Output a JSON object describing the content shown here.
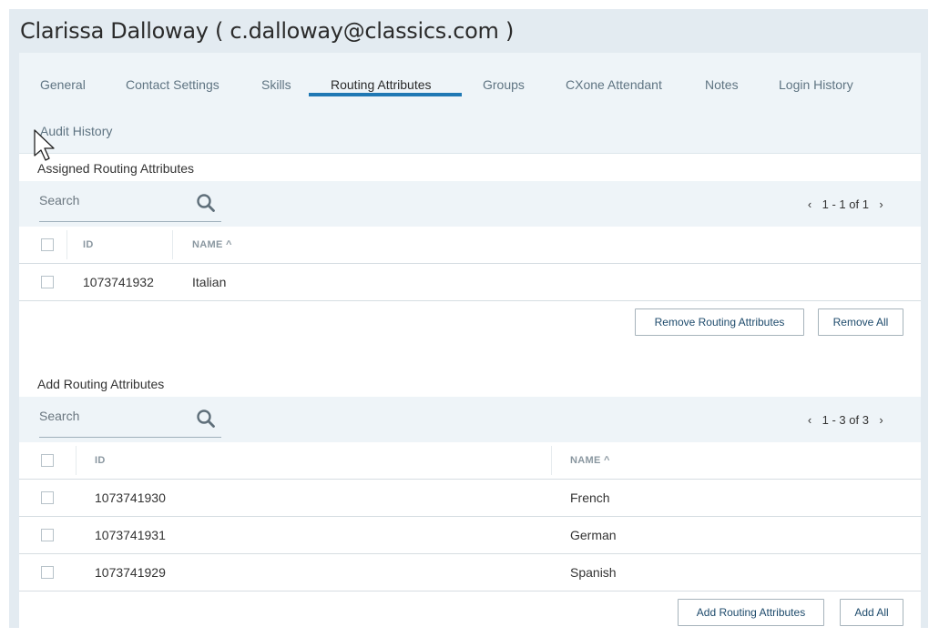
{
  "header": {
    "title": "Clarissa Dalloway ( c.dalloway@classics.com )"
  },
  "tabs": [
    {
      "label": "General"
    },
    {
      "label": "Contact Settings"
    },
    {
      "label": "Skills"
    },
    {
      "label": "Routing Attributes"
    },
    {
      "label": "Groups"
    },
    {
      "label": "CXone Attendant"
    },
    {
      "label": "Notes"
    },
    {
      "label": "Login History"
    },
    {
      "label": "Audit History"
    }
  ],
  "active_tab": "Routing Attributes",
  "assigned": {
    "section_title": "Assigned Routing Attributes",
    "search_placeholder": "Search",
    "pager": {
      "range": "1 - 1 of 1",
      "prev": "‹",
      "next": "›"
    },
    "columns": {
      "id": "ID",
      "name": "NAME ^"
    },
    "rows": [
      {
        "id": "1073741932",
        "name": "Italian"
      }
    ],
    "buttons": {
      "remove": "Remove Routing Attributes",
      "remove_all": "Remove All"
    }
  },
  "available": {
    "section_title": "Add Routing Attributes",
    "search_placeholder": "Search",
    "pager": {
      "range": "1 - 3 of 3",
      "prev": "‹",
      "next": "›"
    },
    "columns": {
      "id": "ID",
      "name": "NAME ^"
    },
    "rows": [
      {
        "id": "1073741930",
        "name": "French"
      },
      {
        "id": "1073741931",
        "name": "German"
      },
      {
        "id": "1073741929",
        "name": "Spanish"
      }
    ],
    "buttons": {
      "add": "Add Routing Attributes",
      "add_all": "Add All"
    }
  },
  "colors": {
    "accent": "#1f78b4",
    "panel_bg": "#eef4f8",
    "outer_bg": "#e3ebf1"
  },
  "icons": {
    "search": "search-icon",
    "cursor": "mouse-pointer-icon"
  }
}
